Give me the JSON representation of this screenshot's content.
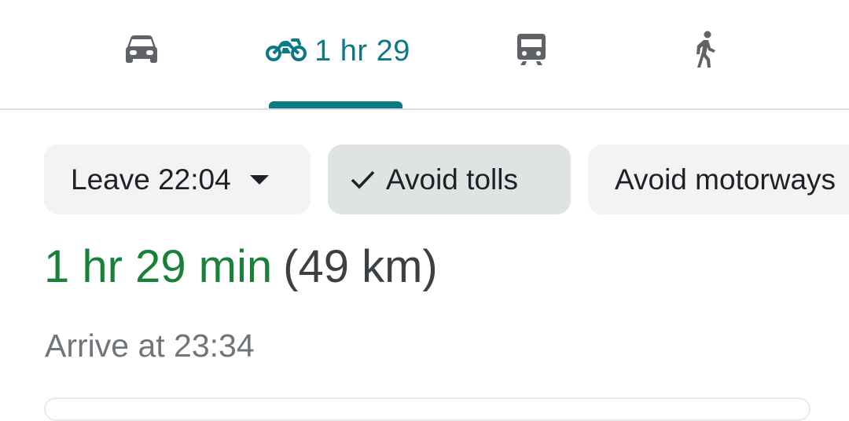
{
  "modes": {
    "car": {
      "icon": "car-icon"
    },
    "motorcycle": {
      "icon": "motorcycle-icon",
      "label": "1 hr 29",
      "selected": true
    },
    "transit": {
      "icon": "train-icon"
    },
    "walk": {
      "icon": "walking-icon"
    }
  },
  "filters": {
    "leave": {
      "label": "Leave 22:04",
      "icon": "dropdown-caret-icon"
    },
    "avoid_tolls": {
      "label": "Avoid tolls",
      "icon": "check-icon",
      "selected": true
    },
    "avoid_motorways": {
      "label": "Avoid motorways"
    }
  },
  "route": {
    "duration": "1 hr 29 min",
    "distance": "(49 km)",
    "arrival": "Arrive at 23:34"
  },
  "colors": {
    "accent": "#0b7a85",
    "duration_green": "#188038",
    "chip_bg": "#f1f3f4",
    "chip_selected_bg": "#dfe3e3"
  }
}
